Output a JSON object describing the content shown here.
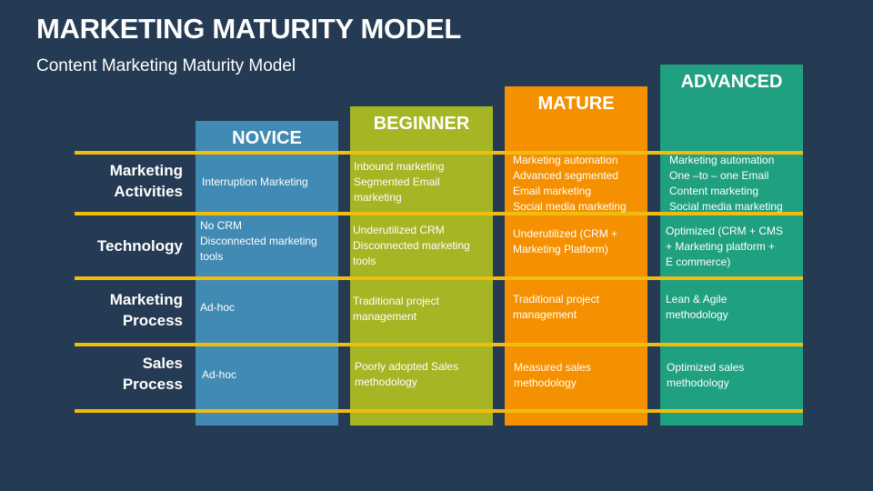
{
  "header": {
    "title": "MARKETING MATURITY MODEL",
    "subtitle": "Content Marketing Maturity Model"
  },
  "colors": {
    "background": "#253a53",
    "divider": "#f0bc0f",
    "novice": "#418ab3",
    "beginner": "#a5b523",
    "mature": "#f59100",
    "advanced": "#1fa080"
  },
  "rows": [
    {
      "label_line1": "Marketing",
      "label_line2": "Activities"
    },
    {
      "label_line1": "Technology",
      "label_line2": ""
    },
    {
      "label_line1": "Marketing",
      "label_line2": "Process"
    },
    {
      "label_line1": "Sales",
      "label_line2": "Process"
    }
  ],
  "stages": [
    {
      "name": "NOVICE",
      "cells": [
        [
          "Interruption Marketing"
        ],
        [
          "No CRM",
          "Disconnected marketing",
          "tools"
        ],
        [
          "Ad-hoc"
        ],
        [
          "Ad-hoc"
        ]
      ]
    },
    {
      "name": "BEGINNER",
      "cells": [
        [
          "Inbound marketing",
          "Segmented Email",
          "marketing"
        ],
        [
          "Underutilized CRM",
          "Disconnected marketing",
          "tools"
        ],
        [
          "Traditional project",
          "management"
        ],
        [
          "Poorly adopted Sales",
          "methodology"
        ]
      ]
    },
    {
      "name": "MATURE",
      "cells": [
        [
          "Marketing automation",
          "Advanced segmented",
          "Email marketing",
          "Social media marketing"
        ],
        [
          "Underutilized (CRM +",
          "Marketing Platform)"
        ],
        [
          "Traditional project",
          "management"
        ],
        [
          "Measured sales",
          "methodology"
        ]
      ]
    },
    {
      "name": "ADVANCED",
      "cells": [
        [
          "Marketing automation",
          "One –to – one Email",
          "Content marketing",
          "Social media marketing"
        ],
        [
          "Optimized (CRM + CMS",
          "+ Marketing platform +",
          "E commerce)"
        ],
        [
          "Lean & Agile",
          "methodology"
        ],
        [
          "Optimized sales",
          "methodology"
        ]
      ]
    }
  ]
}
